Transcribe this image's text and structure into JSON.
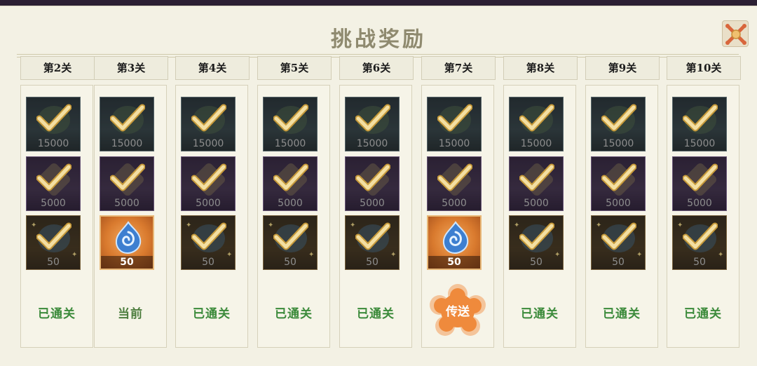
{
  "dialog": {
    "title": "挑战奖励",
    "close_icon": "close-x-icon"
  },
  "colors": {
    "passed_text": "#3b8a3a",
    "teleport_bg": "#ef8a3c",
    "header_text": "#1c1c1c"
  },
  "stages": [
    {
      "label": "第2关",
      "rewards": [
        "15000",
        "5000",
        "50"
      ],
      "claimed": [
        true,
        true,
        true
      ],
      "status": "已通关"
    },
    {
      "label": "第3关",
      "rewards": [
        "15000",
        "5000",
        "50"
      ],
      "claimed": [
        true,
        true,
        false
      ],
      "status": "当前"
    },
    {
      "label": "第4关",
      "rewards": [
        "15000",
        "5000",
        "50"
      ],
      "claimed": [
        true,
        true,
        true
      ],
      "status": "已通关"
    },
    {
      "label": "第5关",
      "rewards": [
        "15000",
        "5000",
        "50"
      ],
      "claimed": [
        true,
        true,
        true
      ],
      "status": "已通关"
    },
    {
      "label": "第6关",
      "rewards": [
        "15000",
        "5000",
        "50"
      ],
      "claimed": [
        true,
        true,
        true
      ],
      "status": "已通关"
    },
    {
      "label": "第7关",
      "rewards": [
        "15000",
        "5000",
        "50"
      ],
      "claimed": [
        true,
        true,
        false
      ],
      "status": "传送",
      "is_button": true
    },
    {
      "label": "第8关",
      "rewards": [
        "15000",
        "5000",
        "50"
      ],
      "claimed": [
        true,
        true,
        true
      ],
      "status": "已通关"
    },
    {
      "label": "第9关",
      "rewards": [
        "15000",
        "5000",
        "50"
      ],
      "claimed": [
        true,
        true,
        true
      ],
      "status": "已通关"
    },
    {
      "label": "第10关",
      "rewards": [
        "15000",
        "5000",
        "50"
      ],
      "claimed": [
        true,
        true,
        true
      ],
      "status": "已通关"
    }
  ]
}
